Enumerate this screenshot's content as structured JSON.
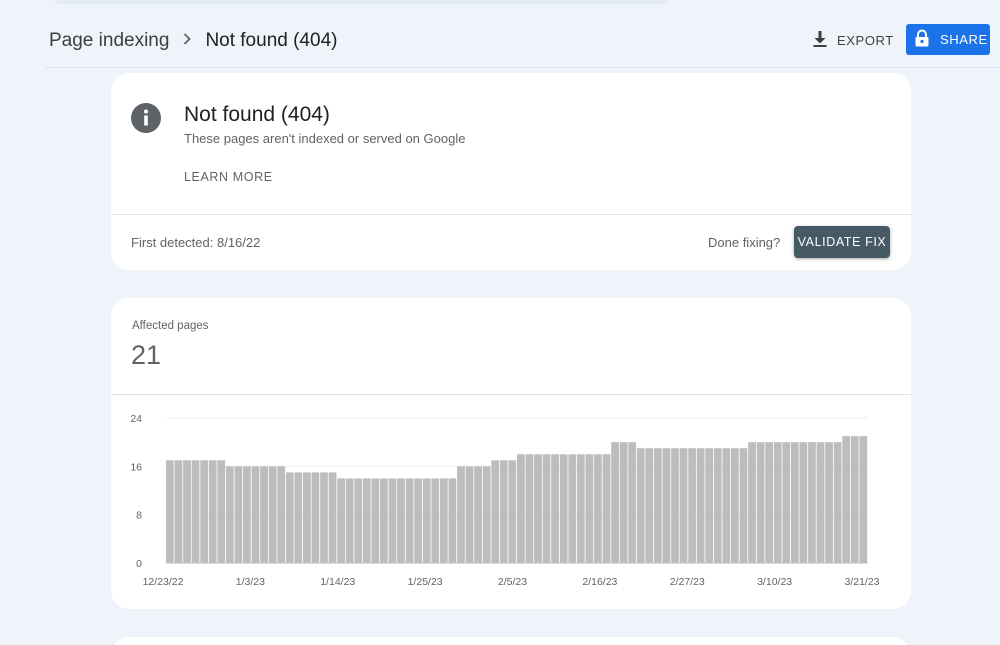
{
  "header": {
    "breadcrumb_parent": "Page indexing",
    "breadcrumb_separator": ">",
    "breadcrumb_current": "Not found (404)",
    "export_label": "EXPORT",
    "share_label": "SHARE",
    "share_color": "#1a73e8"
  },
  "issue": {
    "icon": "info-icon",
    "title": "Not found (404)",
    "description": "These pages aren't indexed or served on Google",
    "learn_more": "LEARN MORE",
    "first_detected": "First detected: 8/16/22",
    "done_fixing": "Done fixing?",
    "validate_label": "VALIDATE FIX",
    "validate_color": "#455a64"
  },
  "affected": {
    "label": "Affected pages",
    "value": "21"
  },
  "chart_data": {
    "type": "bar",
    "title": "",
    "xlabel": "",
    "ylabel": "",
    "ylim": [
      0,
      24
    ],
    "y_ticks": [
      "0",
      "8",
      "16",
      "24"
    ],
    "x_ticks": [
      "12/23/22",
      "1/3/23",
      "1/14/23",
      "1/25/23",
      "2/5/23",
      "2/16/23",
      "2/27/23",
      "3/10/23",
      "3/21/23"
    ],
    "values": [
      17,
      17,
      17,
      17,
      17,
      17,
      17,
      16,
      16,
      16,
      16,
      16,
      16,
      16,
      15,
      15,
      15,
      15,
      15,
      15,
      14,
      14,
      14,
      14,
      14,
      14,
      14,
      14,
      14,
      14,
      14,
      14,
      14,
      14,
      16,
      16,
      16,
      16,
      17,
      17,
      17,
      18,
      18,
      18,
      18,
      18,
      18,
      18,
      18,
      18,
      18,
      18,
      20,
      20,
      20,
      19,
      19,
      19,
      19,
      19,
      19,
      19,
      19,
      19,
      19,
      19,
      19,
      19,
      20,
      20,
      20,
      20,
      20,
      20,
      20,
      20,
      20,
      20,
      20,
      21,
      21,
      21
    ],
    "bar_color": "#bdbdbd",
    "grid": true
  }
}
